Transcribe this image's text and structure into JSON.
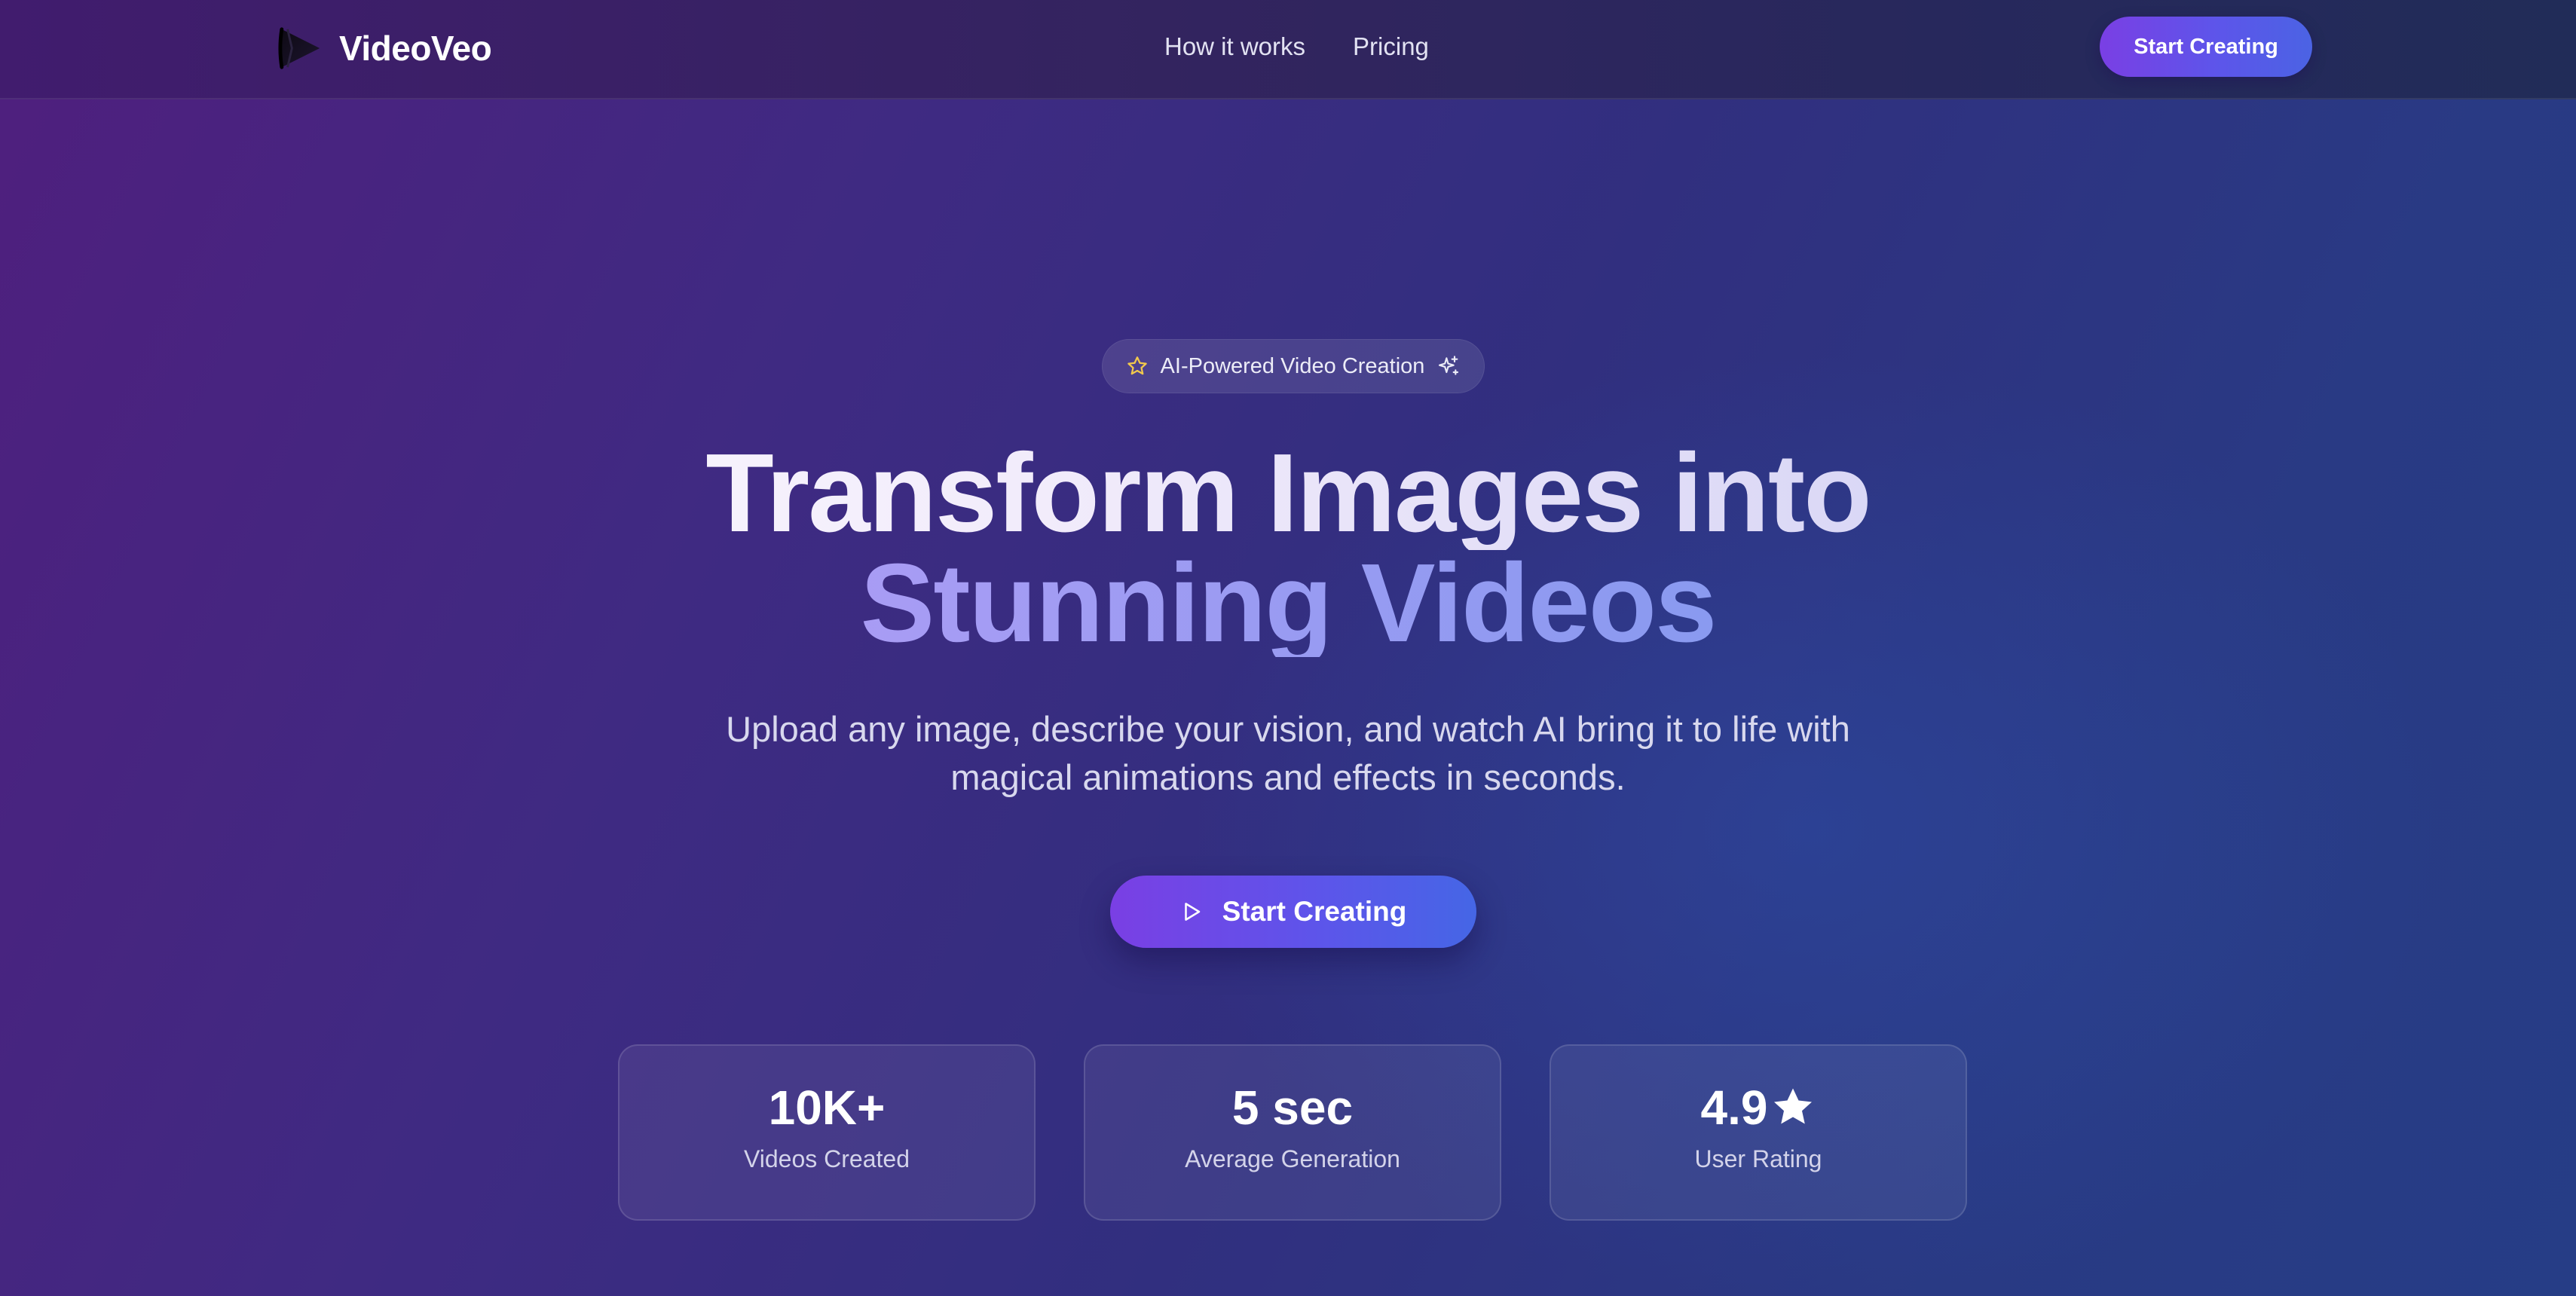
{
  "nav": {
    "brand_name": "VideoVeo",
    "brand_icon": "play-logo-icon",
    "links": [
      {
        "label": "How it works"
      },
      {
        "label": "Pricing"
      }
    ],
    "cta_label": "Start Creating"
  },
  "hero": {
    "badge": {
      "text": "AI-Powered Video Creation",
      "left_icon": "star-icon",
      "right_icon": "sparkles-icon"
    },
    "headline_line1": "Transform Images into",
    "headline_line2": "Stunning Videos",
    "subheadline": "Upload any image, describe your vision, and watch AI bring it to life with magical animations and effects in seconds.",
    "cta": {
      "label": "Start Creating",
      "icon": "play-icon"
    }
  },
  "stats": [
    {
      "value": "10K+",
      "label": "Videos Created"
    },
    {
      "value": "5 sec",
      "label": "Average Generation"
    },
    {
      "value": "4.9",
      "icon": "star-filled-icon",
      "label": "User Rating"
    }
  ],
  "colors": {
    "accent_purple": "#7a3fe4",
    "accent_blue": "#4b63e4",
    "badge_star": "#f2c94c"
  }
}
